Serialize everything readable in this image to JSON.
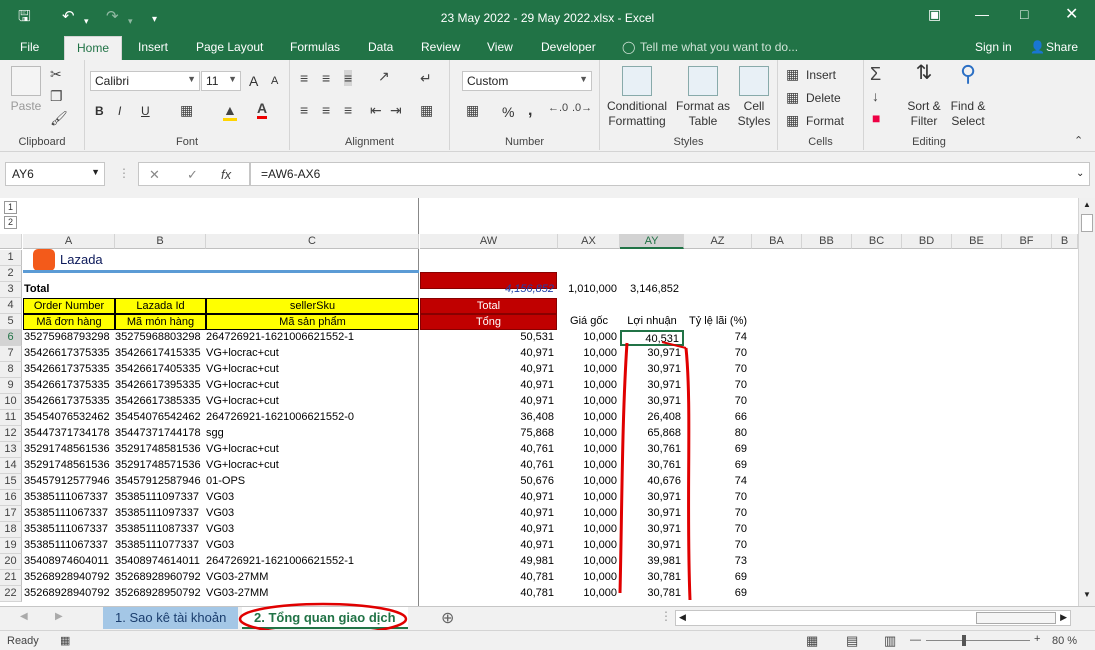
{
  "window": {
    "title": "23 May 2022 - 29 May 2022.xlsx - Excel"
  },
  "ribbon_tabs": [
    "File",
    "Home",
    "Insert",
    "Page Layout",
    "Formulas",
    "Data",
    "Review",
    "View",
    "Developer"
  ],
  "tell_me": "Tell me what you want to do...",
  "account": {
    "sign_in": "Sign in",
    "share": "Share"
  },
  "clipboard": {
    "paste": "Paste",
    "label": "Clipboard"
  },
  "font": {
    "name": "Calibri",
    "size": "11",
    "label": "Font",
    "bold": "B",
    "italic": "I",
    "underline": "U",
    "grow": "A",
    "shrink": "A"
  },
  "alignment": {
    "label": "Alignment"
  },
  "number": {
    "format": "Custom",
    "label": "Number",
    "percent": "%",
    "comma": ","
  },
  "styles": {
    "conditional": [
      "Conditional",
      "Formatting"
    ],
    "table": [
      "Format as",
      "Table"
    ],
    "cell": [
      "Cell",
      "Styles"
    ],
    "label": "Styles"
  },
  "cells": {
    "insert": "Insert",
    "delete": "Delete",
    "format": "Format",
    "label": "Cells"
  },
  "editing": {
    "sort": [
      "Sort &",
      "Filter"
    ],
    "find": [
      "Find &",
      "Select"
    ],
    "label": "Editing"
  },
  "formula_bar": {
    "name_box": "AY6",
    "fx": "fx",
    "formula": "=AW6-AX6"
  },
  "columns": [
    "A",
    "B",
    "C",
    "AW",
    "AX",
    "AY",
    "AZ",
    "BA",
    "BB",
    "BC",
    "BD",
    "BE",
    "BF",
    "B"
  ],
  "brand": {
    "logo_text": "Lazada"
  },
  "sheet": {
    "row3": {
      "label": "Total",
      "aw": "4,156,852",
      "ax": "1,010,000",
      "ay": "3,146,852"
    },
    "row4": {
      "a": "Order Number",
      "b": "Lazada Id",
      "c": "sellerSku",
      "aw": "Total"
    },
    "row5": {
      "a": "Mã đơn hàng",
      "b": "Mã món hàng",
      "c": "Mã sản phẩm",
      "aw": "Tổng",
      "ax": "Giá gốc",
      "ay": "Lợi nhuận",
      "az": "Tỷ lệ lãi (%)"
    },
    "rows": [
      {
        "n": "6",
        "a": "35275968793298",
        "b": "35275968803298",
        "c": "264726921-1621006621552-1",
        "aw": "50,531",
        "ax": "10,000",
        "ay": "40,531",
        "az": "74"
      },
      {
        "n": "7",
        "a": "35426617375335",
        "b": "35426617415335",
        "c": "VG+locrac+cut",
        "aw": "40,971",
        "ax": "10,000",
        "ay": "30,971",
        "az": "70"
      },
      {
        "n": "8",
        "a": "35426617375335",
        "b": "35426617405335",
        "c": "VG+locrac+cut",
        "aw": "40,971",
        "ax": "10,000",
        "ay": "30,971",
        "az": "70"
      },
      {
        "n": "9",
        "a": "35426617375335",
        "b": "35426617395335",
        "c": "VG+locrac+cut",
        "aw": "40,971",
        "ax": "10,000",
        "ay": "30,971",
        "az": "70"
      },
      {
        "n": "10",
        "a": "35426617375335",
        "b": "35426617385335",
        "c": "VG+locrac+cut",
        "aw": "40,971",
        "ax": "10,000",
        "ay": "30,971",
        "az": "70"
      },
      {
        "n": "11",
        "a": "35454076532462",
        "b": "35454076542462",
        "c": "264726921-1621006621552-0",
        "aw": "36,408",
        "ax": "10,000",
        "ay": "26,408",
        "az": "66"
      },
      {
        "n": "12",
        "a": "35447371734178",
        "b": "35447371744178",
        "c": "sgg",
        "aw": "75,868",
        "ax": "10,000",
        "ay": "65,868",
        "az": "80"
      },
      {
        "n": "13",
        "a": "35291748561536",
        "b": "35291748581536",
        "c": "VG+locrac+cut",
        "aw": "40,761",
        "ax": "10,000",
        "ay": "30,761",
        "az": "69"
      },
      {
        "n": "14",
        "a": "35291748561536",
        "b": "35291748571536",
        "c": "VG+locrac+cut",
        "aw": "40,761",
        "ax": "10,000",
        "ay": "30,761",
        "az": "69"
      },
      {
        "n": "15",
        "a": "35457912577946",
        "b": "35457912587946",
        "c": "01-OPS",
        "aw": "50,676",
        "ax": "10,000",
        "ay": "40,676",
        "az": "74"
      },
      {
        "n": "16",
        "a": "35385111067337",
        "b": "35385111097337",
        "c": "VG03",
        "aw": "40,971",
        "ax": "10,000",
        "ay": "30,971",
        "az": "70"
      },
      {
        "n": "17",
        "a": "35385111067337",
        "b": "35385111097337",
        "c": "VG03",
        "aw": "40,971",
        "ax": "10,000",
        "ay": "30,971",
        "az": "70"
      },
      {
        "n": "18",
        "a": "35385111067337",
        "b": "35385111087337",
        "c": "VG03",
        "aw": "40,971",
        "ax": "10,000",
        "ay": "30,971",
        "az": "70"
      },
      {
        "n": "19",
        "a": "35385111067337",
        "b": "35385111077337",
        "c": "VG03",
        "aw": "40,971",
        "ax": "10,000",
        "ay": "30,971",
        "az": "70"
      },
      {
        "n": "20",
        "a": "35408974604011",
        "b": "35408974614011",
        "c": "264726921-1621006621552-1",
        "aw": "49,981",
        "ax": "10,000",
        "ay": "39,981",
        "az": "73"
      },
      {
        "n": "21",
        "a": "35268928940792",
        "b": "35268928960792",
        "c": "VG03-27MM",
        "aw": "40,781",
        "ax": "10,000",
        "ay": "30,781",
        "az": "69"
      },
      {
        "n": "22",
        "a": "35268928940792",
        "b": "35268928950792",
        "c": "VG03-27MM",
        "aw": "40,781",
        "ax": "10,000",
        "ay": "30,781",
        "az": "69"
      }
    ]
  },
  "sheet_tabs": [
    "1. Sao kê tài khoản",
    "2. Tổng quan giao dịch"
  ],
  "status": {
    "ready": "Ready",
    "zoom": "80 %"
  },
  "colors": {
    "excel_green": "#217346",
    "header_yellow": "#ffff00",
    "header_red": "#c00000",
    "annotation_red": "#e00000"
  }
}
